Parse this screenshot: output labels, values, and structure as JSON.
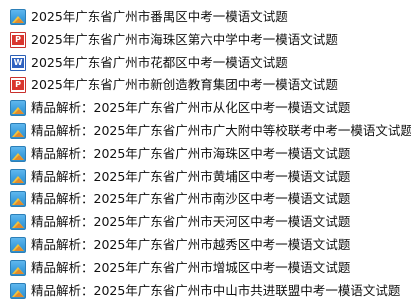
{
  "files": [
    {
      "icon": "image-file-icon",
      "icon_glyph": "",
      "name": "2025年广东省广州市番禺区中考一模语文试题"
    },
    {
      "icon": "pdf-file-icon",
      "icon_glyph": "P",
      "name": "2025年广东省广州市海珠区第六中学中考一模语文试题"
    },
    {
      "icon": "word-file-icon",
      "icon_glyph": "W",
      "name": "2025年广东省广州市花都区中考一模语文试题"
    },
    {
      "icon": "pdf-file-icon",
      "icon_glyph": "P",
      "name": "2025年广东省广州市新创造教育集团中考一模语文试题"
    },
    {
      "icon": "image-file-icon",
      "icon_glyph": "",
      "name": "精品解析：2025年广东省广州市从化区中考一模语文试题"
    },
    {
      "icon": "image-file-icon",
      "icon_glyph": "",
      "name": "精品解析：2025年广东省广州市广大附中等校联考中考一模语文试题"
    },
    {
      "icon": "image-file-icon",
      "icon_glyph": "",
      "name": "精品解析：2025年广东省广州市海珠区中考一模语文试题"
    },
    {
      "icon": "image-file-icon",
      "icon_glyph": "",
      "name": "精品解析：2025年广东省广州市黄埔区中考一模语文试题"
    },
    {
      "icon": "image-file-icon",
      "icon_glyph": "",
      "name": "精品解析：2025年广东省广州市南沙区中考一模语文试题"
    },
    {
      "icon": "image-file-icon",
      "icon_glyph": "",
      "name": "精品解析：2025年广东省广州市天河区中考一模语文试题"
    },
    {
      "icon": "image-file-icon",
      "icon_glyph": "",
      "name": "精品解析：2025年广东省广州市越秀区中考一模语文试题"
    },
    {
      "icon": "image-file-icon",
      "icon_glyph": "",
      "name": "精品解析：2025年广东省广州市增城区中考一模语文试题"
    },
    {
      "icon": "image-file-icon",
      "icon_glyph": "",
      "name": "精品解析：2025年广东省广州市中山市共进联盟中考一模语文试题"
    }
  ]
}
